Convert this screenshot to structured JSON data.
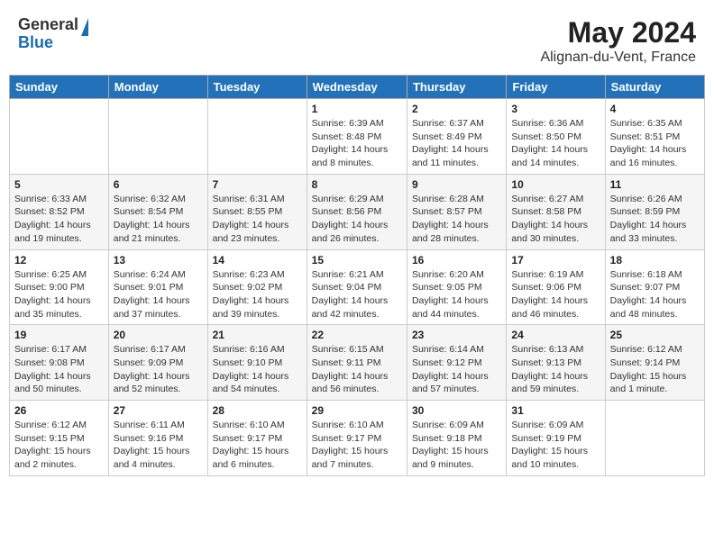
{
  "header": {
    "logo_general": "General",
    "logo_blue": "Blue",
    "month_year": "May 2024",
    "location": "Alignan-du-Vent, France"
  },
  "days_of_week": [
    "Sunday",
    "Monday",
    "Tuesday",
    "Wednesday",
    "Thursday",
    "Friday",
    "Saturday"
  ],
  "weeks": [
    [
      {
        "day": "",
        "info": ""
      },
      {
        "day": "",
        "info": ""
      },
      {
        "day": "",
        "info": ""
      },
      {
        "day": "1",
        "info": "Sunrise: 6:39 AM\nSunset: 8:48 PM\nDaylight: 14 hours\nand 8 minutes."
      },
      {
        "day": "2",
        "info": "Sunrise: 6:37 AM\nSunset: 8:49 PM\nDaylight: 14 hours\nand 11 minutes."
      },
      {
        "day": "3",
        "info": "Sunrise: 6:36 AM\nSunset: 8:50 PM\nDaylight: 14 hours\nand 14 minutes."
      },
      {
        "day": "4",
        "info": "Sunrise: 6:35 AM\nSunset: 8:51 PM\nDaylight: 14 hours\nand 16 minutes."
      }
    ],
    [
      {
        "day": "5",
        "info": "Sunrise: 6:33 AM\nSunset: 8:52 PM\nDaylight: 14 hours\nand 19 minutes."
      },
      {
        "day": "6",
        "info": "Sunrise: 6:32 AM\nSunset: 8:54 PM\nDaylight: 14 hours\nand 21 minutes."
      },
      {
        "day": "7",
        "info": "Sunrise: 6:31 AM\nSunset: 8:55 PM\nDaylight: 14 hours\nand 23 minutes."
      },
      {
        "day": "8",
        "info": "Sunrise: 6:29 AM\nSunset: 8:56 PM\nDaylight: 14 hours\nand 26 minutes."
      },
      {
        "day": "9",
        "info": "Sunrise: 6:28 AM\nSunset: 8:57 PM\nDaylight: 14 hours\nand 28 minutes."
      },
      {
        "day": "10",
        "info": "Sunrise: 6:27 AM\nSunset: 8:58 PM\nDaylight: 14 hours\nand 30 minutes."
      },
      {
        "day": "11",
        "info": "Sunrise: 6:26 AM\nSunset: 8:59 PM\nDaylight: 14 hours\nand 33 minutes."
      }
    ],
    [
      {
        "day": "12",
        "info": "Sunrise: 6:25 AM\nSunset: 9:00 PM\nDaylight: 14 hours\nand 35 minutes."
      },
      {
        "day": "13",
        "info": "Sunrise: 6:24 AM\nSunset: 9:01 PM\nDaylight: 14 hours\nand 37 minutes."
      },
      {
        "day": "14",
        "info": "Sunrise: 6:23 AM\nSunset: 9:02 PM\nDaylight: 14 hours\nand 39 minutes."
      },
      {
        "day": "15",
        "info": "Sunrise: 6:21 AM\nSunset: 9:04 PM\nDaylight: 14 hours\nand 42 minutes."
      },
      {
        "day": "16",
        "info": "Sunrise: 6:20 AM\nSunset: 9:05 PM\nDaylight: 14 hours\nand 44 minutes."
      },
      {
        "day": "17",
        "info": "Sunrise: 6:19 AM\nSunset: 9:06 PM\nDaylight: 14 hours\nand 46 minutes."
      },
      {
        "day": "18",
        "info": "Sunrise: 6:18 AM\nSunset: 9:07 PM\nDaylight: 14 hours\nand 48 minutes."
      }
    ],
    [
      {
        "day": "19",
        "info": "Sunrise: 6:17 AM\nSunset: 9:08 PM\nDaylight: 14 hours\nand 50 minutes."
      },
      {
        "day": "20",
        "info": "Sunrise: 6:17 AM\nSunset: 9:09 PM\nDaylight: 14 hours\nand 52 minutes."
      },
      {
        "day": "21",
        "info": "Sunrise: 6:16 AM\nSunset: 9:10 PM\nDaylight: 14 hours\nand 54 minutes."
      },
      {
        "day": "22",
        "info": "Sunrise: 6:15 AM\nSunset: 9:11 PM\nDaylight: 14 hours\nand 56 minutes."
      },
      {
        "day": "23",
        "info": "Sunrise: 6:14 AM\nSunset: 9:12 PM\nDaylight: 14 hours\nand 57 minutes."
      },
      {
        "day": "24",
        "info": "Sunrise: 6:13 AM\nSunset: 9:13 PM\nDaylight: 14 hours\nand 59 minutes."
      },
      {
        "day": "25",
        "info": "Sunrise: 6:12 AM\nSunset: 9:14 PM\nDaylight: 15 hours\nand 1 minute."
      }
    ],
    [
      {
        "day": "26",
        "info": "Sunrise: 6:12 AM\nSunset: 9:15 PM\nDaylight: 15 hours\nand 2 minutes."
      },
      {
        "day": "27",
        "info": "Sunrise: 6:11 AM\nSunset: 9:16 PM\nDaylight: 15 hours\nand 4 minutes."
      },
      {
        "day": "28",
        "info": "Sunrise: 6:10 AM\nSunset: 9:17 PM\nDaylight: 15 hours\nand 6 minutes."
      },
      {
        "day": "29",
        "info": "Sunrise: 6:10 AM\nSunset: 9:17 PM\nDaylight: 15 hours\nand 7 minutes."
      },
      {
        "day": "30",
        "info": "Sunrise: 6:09 AM\nSunset: 9:18 PM\nDaylight: 15 hours\nand 9 minutes."
      },
      {
        "day": "31",
        "info": "Sunrise: 6:09 AM\nSunset: 9:19 PM\nDaylight: 15 hours\nand 10 minutes."
      },
      {
        "day": "",
        "info": ""
      }
    ]
  ]
}
